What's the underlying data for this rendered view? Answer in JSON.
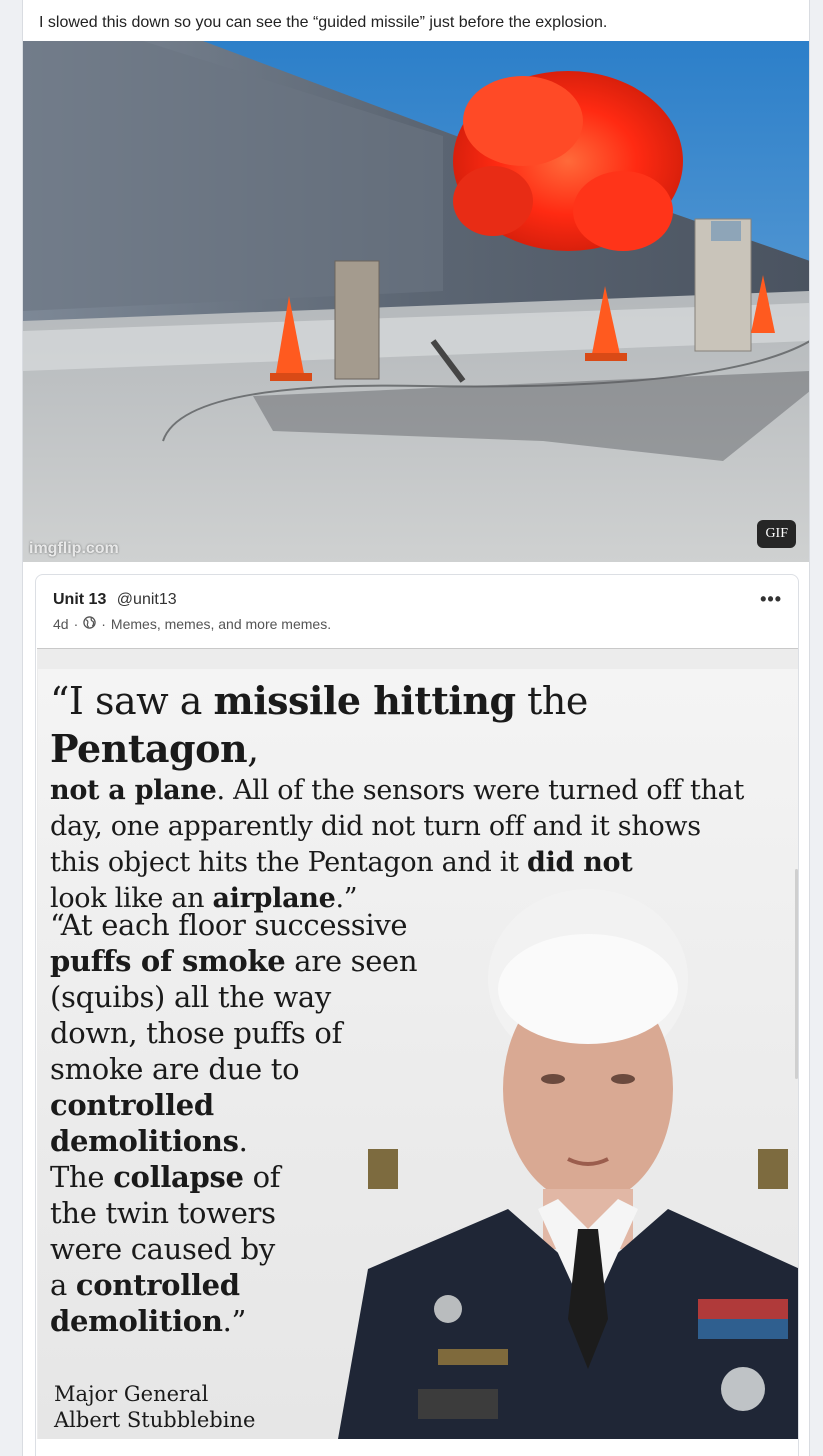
{
  "post": {
    "caption": "I slowed this down so you can see the “guided missile” just before the explosion.",
    "gif_watermark": "imgflip.com",
    "gif_badge": "GIF"
  },
  "shared_post": {
    "author_name": "Unit 13",
    "author_handle": "@unit13",
    "age": "4d",
    "separator": "·",
    "audience_icon": "globe-icon",
    "description": "Memes, memes, and more memes.",
    "more_label": "•••",
    "meme": {
      "quote1_lines": [
        [
          "“I saw a ",
          "missile hitting",
          " the ",
          "Pentagon",
          ","
        ],
        [
          "not a plane",
          ". All of the sensors were turned off that"
        ],
        [
          "day, one apparently did not turn off and it shows"
        ],
        [
          "this object hits the Pentagon and it ",
          "did not"
        ],
        [
          "look like an ",
          "airplane",
          ".”"
        ]
      ],
      "quote2_lines": [
        [
          "“At each floor successive"
        ],
        [
          "puffs of smoke",
          " are seen"
        ],
        [
          "(squibs) all the way"
        ],
        [
          "down, those puffs of"
        ],
        [
          "smoke are due to"
        ],
        [
          "controlled"
        ],
        [
          "demolitions",
          "."
        ],
        [
          "The ",
          "collapse",
          " of"
        ],
        [
          "the twin towers"
        ],
        [
          "were caused by"
        ],
        [
          "a ",
          "controlled"
        ],
        [
          "demolition",
          ".”"
        ]
      ],
      "attribution_title": "Major General",
      "attribution_name": "Albert Stubblebine"
    }
  },
  "colors": {
    "page_bg": "#eef0f3",
    "card_bg": "#ffffff",
    "fire": "#ff3b1f",
    "uniform": "#1f2636"
  }
}
